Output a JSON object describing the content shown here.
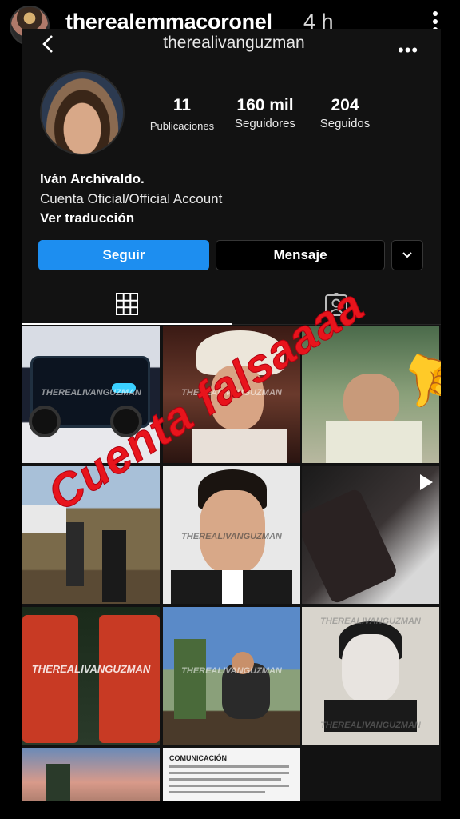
{
  "story": {
    "username": "therealemmacoronel",
    "time": "4 h"
  },
  "profile": {
    "username": "therealivanguzman",
    "stats": [
      {
        "value": "11",
        "label": "Publicaciones"
      },
      {
        "value": "160 mil",
        "label": "Seguidores"
      },
      {
        "value": "204",
        "label": "Seguidos"
      }
    ],
    "bio": {
      "name": "Iván Archivaldo.",
      "text": "Cuenta Oficial/Official Account",
      "translate": "Ver traducción"
    },
    "buttons": {
      "follow": "Seguir",
      "message": "Mensaje"
    }
  },
  "grid": {
    "watermark": "THEREALIVANGUZMAN",
    "doc_heading": "COMUNICACIÓN"
  },
  "overlay": {
    "text": "Cuenta falsaaaa"
  },
  "colors": {
    "follow_button": "#1d8ef0",
    "overlay_text": "#e8141c",
    "background": "#121212"
  }
}
